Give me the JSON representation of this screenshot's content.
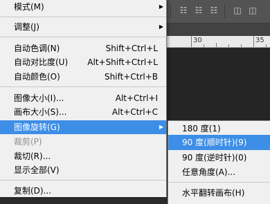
{
  "menu": {
    "items": [
      {
        "label": "模式(M)"
      },
      {
        "label": "调整(J)"
      },
      {
        "label": "自动色调(N)",
        "shortcut": "Shift+Ctrl+L"
      },
      {
        "label": "自动对比度(U)",
        "shortcut": "Alt+Shift+Ctrl+L"
      },
      {
        "label": "自动颜色(O)",
        "shortcut": "Shift+Ctrl+B"
      },
      {
        "label": "图像大小(I)...",
        "shortcut": "Alt+Ctrl+I"
      },
      {
        "label": "画布大小(S)...",
        "shortcut": "Alt+Ctrl+C"
      },
      {
        "label": "图像旋转(G)"
      },
      {
        "label": "裁剪(P)"
      },
      {
        "label": "裁切(R)..."
      },
      {
        "label": "显示全部(V)"
      },
      {
        "label": "复制(D)..."
      }
    ]
  },
  "submenu": {
    "items": [
      {
        "label": "180 度(1)"
      },
      {
        "label": "90 度(顺时针)(9)"
      },
      {
        "label": "90 度(逆时针)(0)"
      },
      {
        "label": "任意角度(A)..."
      },
      {
        "label": "水平翻转画布(H)"
      }
    ]
  },
  "ruler": {
    "labels": [
      "30",
      "35"
    ]
  },
  "colors": {
    "highlight": "#3d8ee6",
    "menu_bg": "#f0f0f0",
    "app_bg": "#2b2b2b"
  },
  "icons": [
    "chevron-right-icon",
    "align-top-icon",
    "align-vcenter-icon",
    "align-bottom-icon",
    "align-left-icon"
  ]
}
